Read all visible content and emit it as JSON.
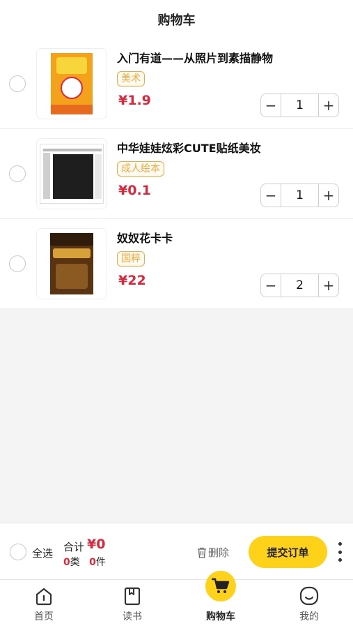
{
  "header": {
    "title": "购物车"
  },
  "items": [
    {
      "name": "入门有道——从照片到素描静物",
      "tag": "美术",
      "price": "¥1.9",
      "quantity": "1",
      "cover_icon": "book-cover-art"
    },
    {
      "name": "中华娃娃炫彩CUTE贴纸美妆",
      "tag": "成人绘本",
      "price": "¥0.1",
      "quantity": "1",
      "cover_icon": "book-cover-screenshot"
    },
    {
      "name": "奴奴花卡卡",
      "tag": "国粹",
      "price": "¥22",
      "quantity": "2",
      "cover_icon": "book-cover-novel"
    }
  ],
  "stepper": {
    "minus": "−",
    "plus": "+"
  },
  "footer": {
    "select_all": "全选",
    "total_label": "合计",
    "total_value": "¥0",
    "kinds_num": "0",
    "kinds_unit": "类",
    "pieces_num": "0",
    "pieces_unit": "件",
    "delete_label": "删除",
    "submit_label": "提交订单"
  },
  "tabbar": [
    {
      "label": "首页",
      "icon": "home-icon"
    },
    {
      "label": "读书",
      "icon": "book-icon"
    },
    {
      "label": "购物车",
      "icon": "cart-icon"
    },
    {
      "label": "我的",
      "icon": "smile-icon"
    }
  ],
  "colors": {
    "accent": "#ffd21a",
    "price": "#e0263a",
    "tag": "#f2a93b"
  }
}
